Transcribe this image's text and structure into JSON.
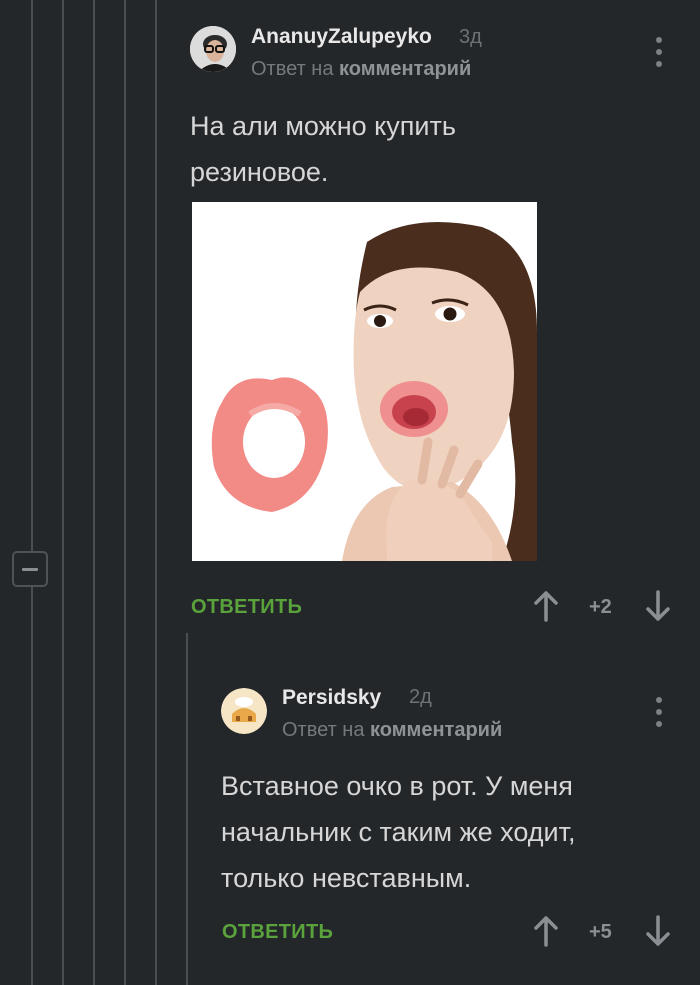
{
  "comments": [
    {
      "username": "AnanuyZalupeyko",
      "age": "3д",
      "reply_prefix": "Ответ на",
      "reply_target": "комментарий",
      "text_lines": [
        "На али можно купить",
        "резиновое."
      ],
      "reply_label": "ОТВЕТИТЬ",
      "score": "+2"
    },
    {
      "username": "Persidsky",
      "age": "2д",
      "reply_prefix": "Ответ на",
      "reply_target": "комментарий",
      "text_lines": [
        "Вставное очко в рот. У меня",
        "начальник с таким же ходит,",
        "только невставным."
      ],
      "reply_label": "ОТВЕТИТЬ",
      "score": "+5"
    }
  ],
  "colors": {
    "background": "#24272a",
    "reply_green": "#5aa23b",
    "thread_line": "#4a4e52"
  }
}
